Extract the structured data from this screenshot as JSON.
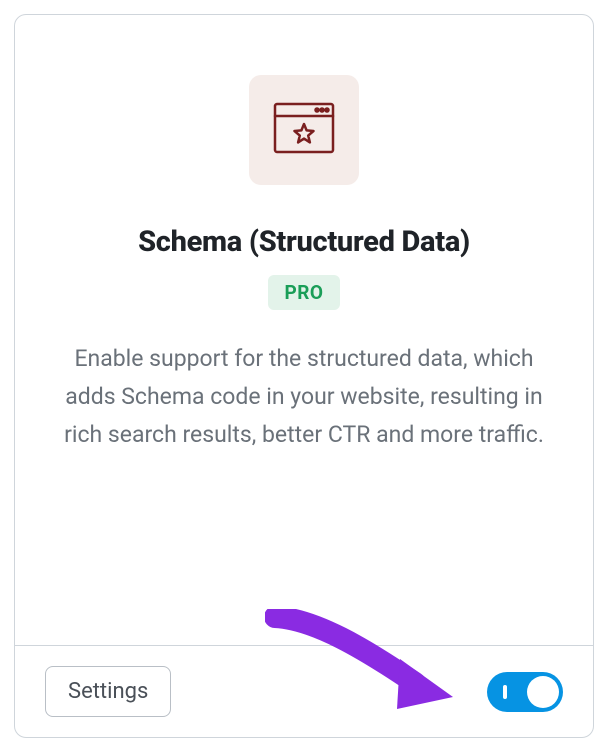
{
  "card": {
    "title": "Schema (Structured Data)",
    "badge": "PRO",
    "description": "Enable support for the structured data, which adds Schema code in your website, resulting in rich search results, better CTR and more traffic.",
    "settings_label": "Settings",
    "toggle_on": true
  },
  "colors": {
    "icon_bg": "#f5ece9",
    "icon_stroke": "#7a1f1f",
    "badge_bg": "#e3f3ea",
    "badge_text": "#1a9e58",
    "toggle_on_bg": "#0693e3",
    "annotation_arrow": "#8a2be2"
  }
}
